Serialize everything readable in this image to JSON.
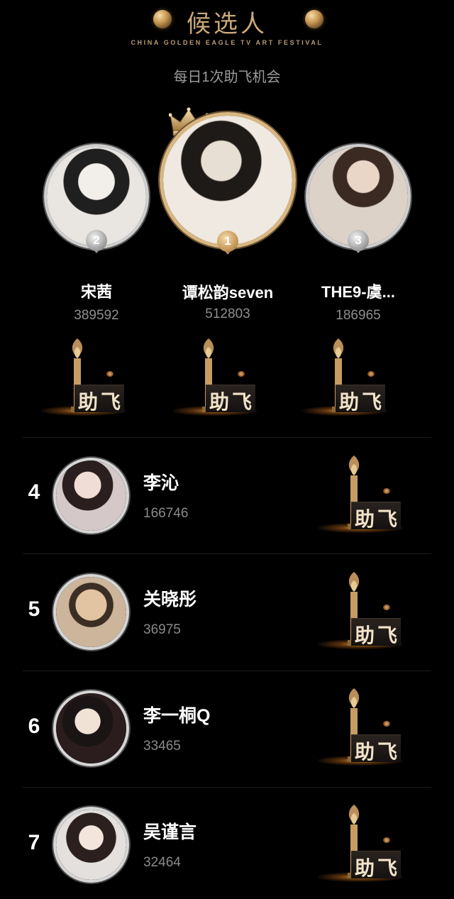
{
  "header": {
    "title": "候选人",
    "subtitle_en": "CHINA GOLDEN EAGLE TV ART FESTIVAL",
    "daily_note": "每日1次助飞机会"
  },
  "boost_label": "助飞",
  "podium": [
    {
      "rank": "2",
      "name": "宋茜",
      "votes": "389592"
    },
    {
      "rank": "1",
      "name": "谭松韵seven",
      "votes": "512803"
    },
    {
      "rank": "3",
      "name": "THE9-虞...",
      "votes": "186965"
    }
  ],
  "ranking": [
    {
      "rank": "4",
      "name": "李沁",
      "votes": "166746"
    },
    {
      "rank": "5",
      "name": "关晓彤",
      "votes": "36975"
    },
    {
      "rank": "6",
      "name": "李一桐Q",
      "votes": "33465"
    },
    {
      "rank": "7",
      "name": "吴谨言",
      "votes": "32464"
    }
  ],
  "colors": {
    "background": "#000000",
    "gold_accent": "#c9a878",
    "muted_text": "#8e8e8e"
  }
}
